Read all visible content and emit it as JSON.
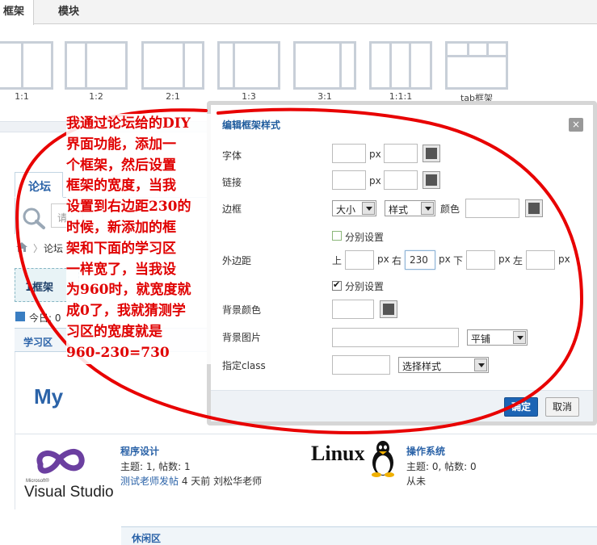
{
  "tabs": {
    "frame": "框架",
    "module": "模块"
  },
  "layouts": [
    {
      "id": "1:1",
      "label": "1:1"
    },
    {
      "id": "1:2",
      "label": "1:2"
    },
    {
      "id": "2:1",
      "label": "2:1"
    },
    {
      "id": "1:3",
      "label": "1:3"
    },
    {
      "id": "3:1",
      "label": "3:1"
    },
    {
      "id": "1:1:1",
      "label": "1:1:1"
    },
    {
      "id": "tab",
      "label": "tab框架"
    }
  ],
  "forum": {
    "tab": "论坛",
    "search_placeholder": "请",
    "breadcrumb": "论坛",
    "diy_frame": "1框架",
    "today": "今日: 0",
    "study_area": "学习区",
    "logo_partial": "My",
    "sections": [
      {
        "logo_ms": "Microsoft®",
        "logo_name": "Visual Studio",
        "title": "程序设计",
        "stats": "主题: 1, 帖数: 1",
        "last_post_link": "测试老师发帖",
        "last_post_meta": " 4 天前 刘松华老师"
      },
      {
        "logo_name": "Linux",
        "title": "操作系统",
        "stats": "主题: 0, 帖数: 0",
        "last_post": "从未"
      }
    ],
    "leisure_area": "休闲区"
  },
  "dialog": {
    "title": "编辑框架样式",
    "close_label": "×",
    "font_label": "字体",
    "link_label": "链接",
    "border_label": "边框",
    "margin_label": "外边距",
    "bgcolor_label": "背景颜色",
    "bgimage_label": "背景图片",
    "class_label": "指定class",
    "unit_px": "px",
    "border_size": "大小",
    "border_style": "样式",
    "color_label": "颜色",
    "separate_setting": "分别设置",
    "separate_border_checked": false,
    "separate_margin_checked": true,
    "margin_top_label": "上",
    "margin_right_label": "右",
    "margin_right_value": "230",
    "margin_bottom_label": "下",
    "margin_left_label": "左",
    "bg_repeat": "平铺",
    "class_select": "选择样式",
    "ok": "确定",
    "cancel": "取消"
  },
  "annotation": {
    "lines": [
      "我通过论坛给的DIY",
      "界面功能，添加一",
      "个框架，然后设置",
      "框架的宽度，当我",
      "设置到右边距230的",
      "时候，新添加的框",
      "架和下面的学习区",
      "一样宽了，当我设",
      "为960时，就宽度就",
      "成0了，我就猜测学",
      "习区的宽度就是",
      "960-230=730"
    ],
    "color": "#e00000"
  }
}
